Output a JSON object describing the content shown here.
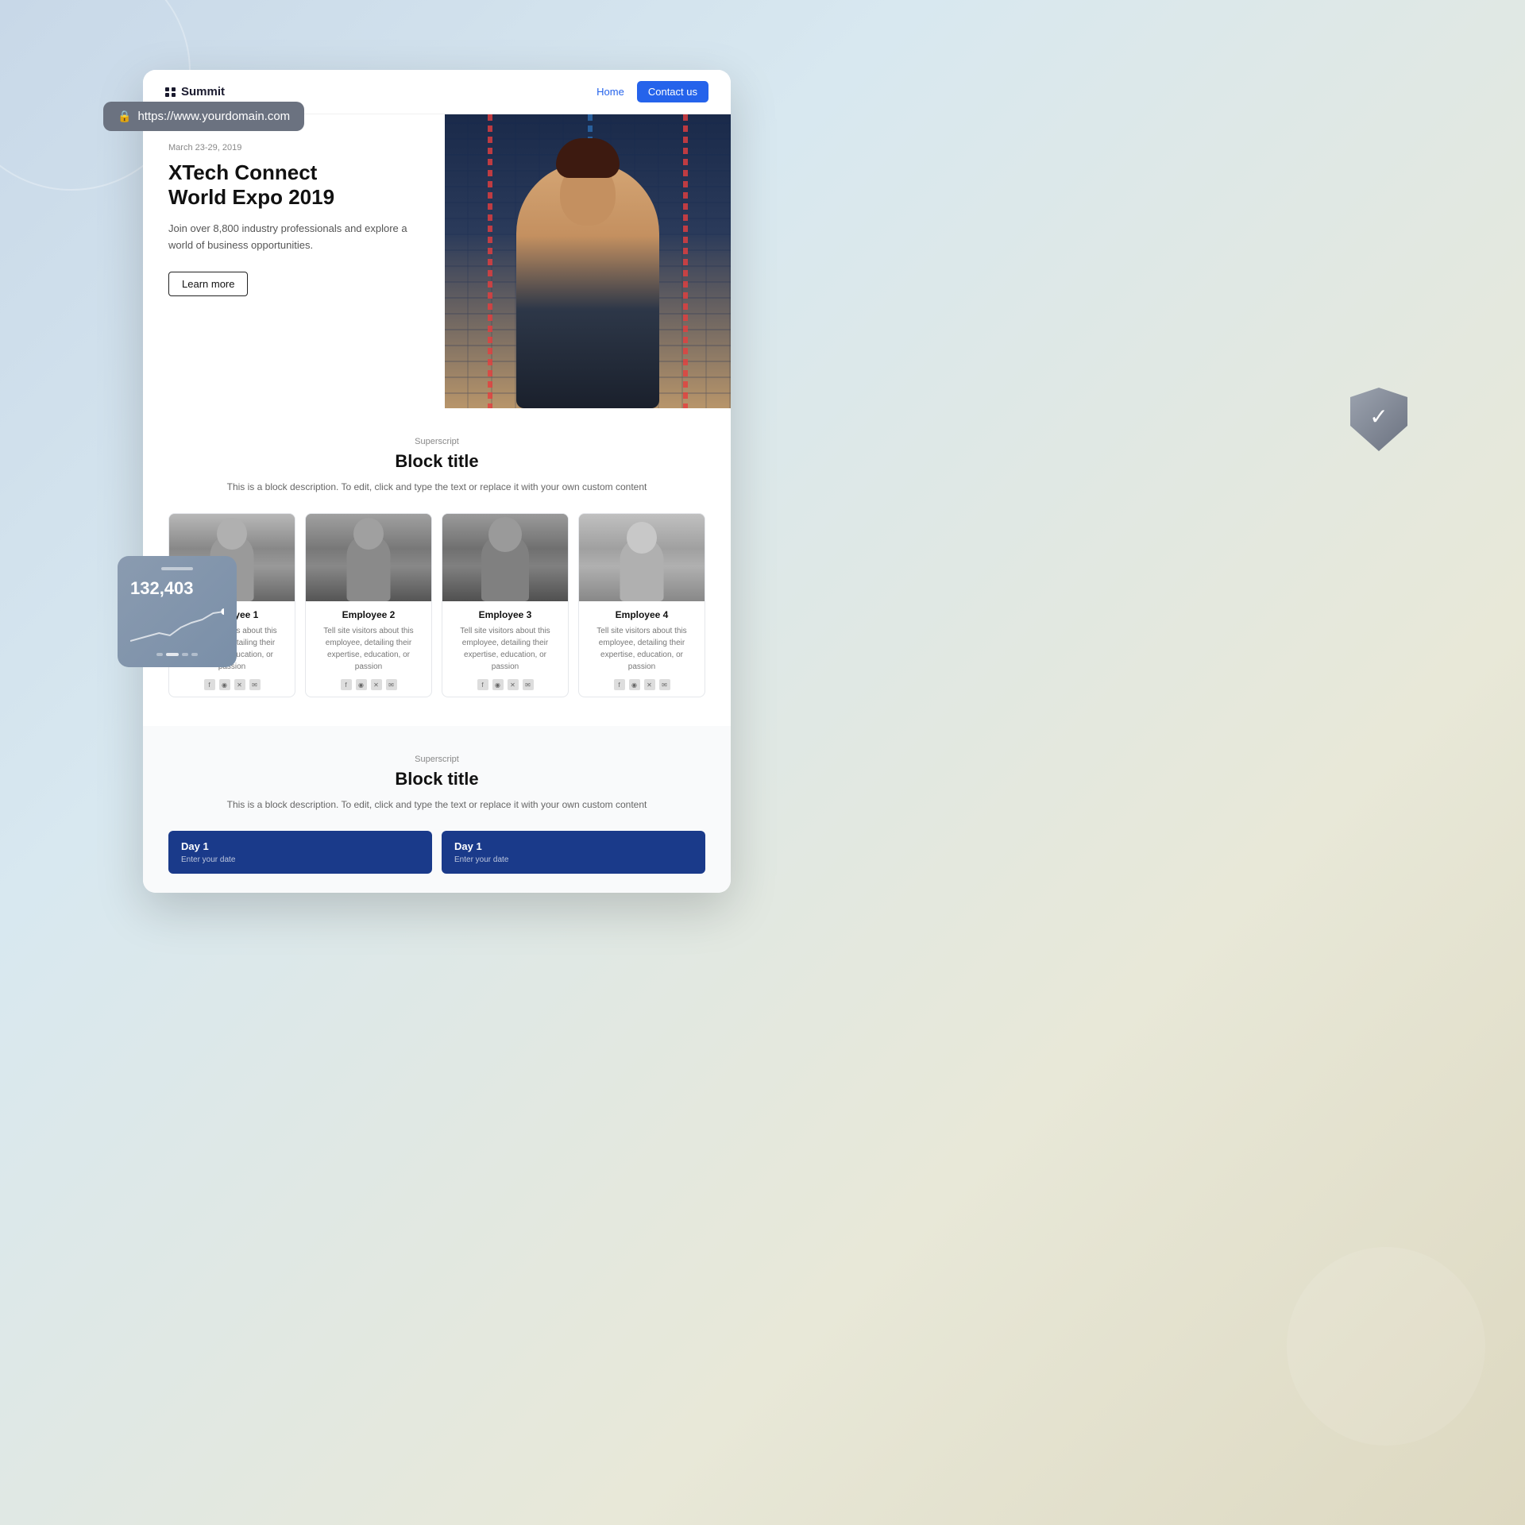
{
  "background": {
    "colors": [
      "#c8d8e8",
      "#e8e8d8"
    ]
  },
  "url_bar": {
    "url": "https://www.yourdomain.com",
    "lock_icon": "🔒"
  },
  "nav": {
    "logo": "Summit",
    "home_link": "Home",
    "contact_button": "Contact us"
  },
  "hero": {
    "date": "March 23-29, 2019",
    "title_line1": "XTech Connect",
    "title_line2": "World Expo 2019",
    "description": "Join over 8,800 industry professionals and explore a world of business opportunities.",
    "cta_button": "Learn more"
  },
  "team_section": {
    "superscript": "Superscript",
    "title": "Block title",
    "description": "This is a block description. To edit, click and type the text or replace it with your own custom content",
    "employees": [
      {
        "name": "Employee 1",
        "bio": "Tell site visitors about this employee, detailing their expertise, education, or passion"
      },
      {
        "name": "Employee 2",
        "bio": "Tell site visitors about this employee, detailing their expertise, education, or passion"
      },
      {
        "name": "Employee 3",
        "bio": "Tell site visitors about this employee, detailing their expertise, education, or passion"
      },
      {
        "name": "Employee 4",
        "bio": "Tell site visitors about this employee, detailing their expertise, education, or passion"
      }
    ],
    "socials": [
      "f",
      "ig",
      "x",
      "✉"
    ]
  },
  "second_section": {
    "superscript": "Superscript",
    "title": "Block title",
    "description": "This is a block description. To edit, click and type the text or replace it with your own custom content",
    "day_cards": [
      {
        "title": "Day 1",
        "subtitle": "Enter your date"
      },
      {
        "title": "Day 1",
        "subtitle": "Enter your date"
      }
    ]
  },
  "stats_card": {
    "number": "132,403"
  },
  "shield": {
    "check": "✓"
  }
}
